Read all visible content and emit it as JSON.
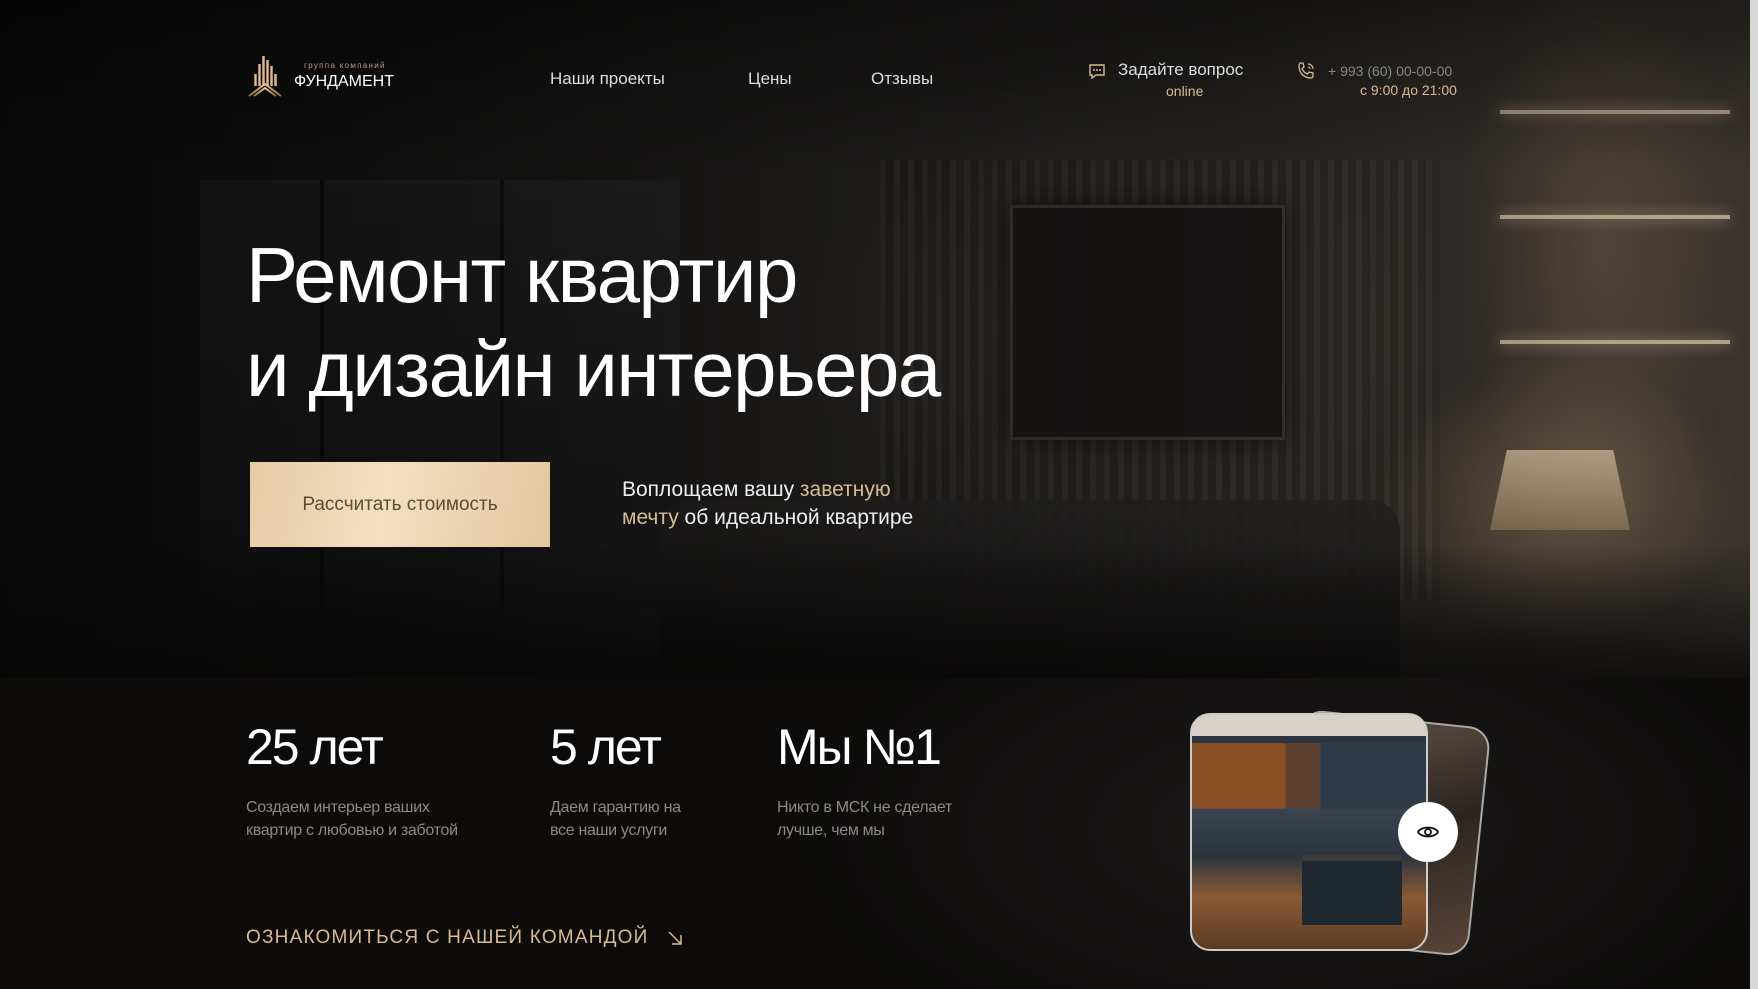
{
  "logo": {
    "subtitle": "группа компаний",
    "name": "ФУНДАМЕНТ"
  },
  "nav": [
    {
      "label": "Наши проекты"
    },
    {
      "label": "Цены"
    },
    {
      "label": "Отзывы"
    }
  ],
  "contact": {
    "ask_label": "Задайте вопрос",
    "ask_sub": "online",
    "phone": "+ 993 (60) 00-00-00",
    "hours": "с 9:00 до 21:00"
  },
  "hero": {
    "title_line1": "Ремонт квартир",
    "title_line2": "и дизайн интерьера",
    "cta_label": "Рассчитать стоимость",
    "tagline": {
      "part1": "Воплощаем вашу ",
      "highlight1": "заветную",
      "highlight2": "мечту",
      "part2": " об идеальной квартире"
    }
  },
  "stats": [
    {
      "value": "25 лет",
      "desc_line1": "Создаем интерьер ваших",
      "desc_line2": "квартир с любовью и заботой"
    },
    {
      "value": "5 лет",
      "desc_line1": "Даем гарантию на",
      "desc_line2": "все наши услуги"
    },
    {
      "value": "Мы №1",
      "desc_line1": "Никто в МСК не сделает",
      "desc_line2": "лучше, чем мы"
    }
  ],
  "team_link": {
    "label": "ОЗНАКОМИТЬСЯ С НАШЕЙ КОМАНДОЙ",
    "icon": "arrow-down-right-icon"
  },
  "colors": {
    "accent": "#d9bb92",
    "button": "#ecd5b2",
    "background": "#0c0b0a"
  }
}
